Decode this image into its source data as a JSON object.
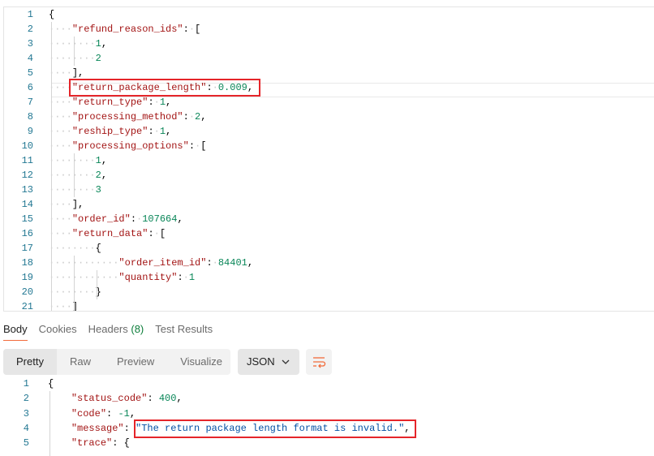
{
  "request_body": {
    "active_line": 6,
    "lines": [
      {
        "indent": 0,
        "tokens": [
          [
            "p",
            "{"
          ]
        ]
      },
      {
        "indent": 1,
        "tokens": [
          [
            "k",
            "\"refund_reason_ids\""
          ],
          [
            "p",
            ":"
          ],
          [
            "w",
            "·"
          ],
          [
            "p",
            "["
          ]
        ]
      },
      {
        "indent": 2,
        "tokens": [
          [
            "n",
            "1"
          ],
          [
            "p",
            ","
          ]
        ]
      },
      {
        "indent": 2,
        "tokens": [
          [
            "n",
            "2"
          ]
        ]
      },
      {
        "indent": 1,
        "tokens": [
          [
            "p",
            "],"
          ]
        ]
      },
      {
        "indent": 1,
        "tokens": [
          [
            "k",
            "\"return_package_length\""
          ],
          [
            "p",
            ":"
          ],
          [
            "w",
            "·"
          ],
          [
            "n",
            "0.009"
          ],
          [
            "p",
            ","
          ]
        ]
      },
      {
        "indent": 1,
        "tokens": [
          [
            "k",
            "\"return_type\""
          ],
          [
            "p",
            ":"
          ],
          [
            "w",
            "·"
          ],
          [
            "n",
            "1"
          ],
          [
            "p",
            ","
          ]
        ]
      },
      {
        "indent": 1,
        "tokens": [
          [
            "k",
            "\"processing_method\""
          ],
          [
            "p",
            ":"
          ],
          [
            "w",
            "·"
          ],
          [
            "n",
            "2"
          ],
          [
            "p",
            ","
          ]
        ]
      },
      {
        "indent": 1,
        "tokens": [
          [
            "k",
            "\"reship_type\""
          ],
          [
            "p",
            ":"
          ],
          [
            "w",
            "·"
          ],
          [
            "n",
            "1"
          ],
          [
            "p",
            ","
          ]
        ]
      },
      {
        "indent": 1,
        "tokens": [
          [
            "k",
            "\"processing_options\""
          ],
          [
            "p",
            ":"
          ],
          [
            "w",
            "·"
          ],
          [
            "p",
            "["
          ]
        ]
      },
      {
        "indent": 2,
        "tokens": [
          [
            "n",
            "1"
          ],
          [
            "p",
            ","
          ]
        ]
      },
      {
        "indent": 2,
        "tokens": [
          [
            "n",
            "2"
          ],
          [
            "p",
            ","
          ]
        ]
      },
      {
        "indent": 2,
        "tokens": [
          [
            "n",
            "3"
          ]
        ]
      },
      {
        "indent": 1,
        "tokens": [
          [
            "p",
            "],"
          ]
        ]
      },
      {
        "indent": 1,
        "tokens": [
          [
            "k",
            "\"order_id\""
          ],
          [
            "p",
            ":"
          ],
          [
            "w",
            "·"
          ],
          [
            "n",
            "107664"
          ],
          [
            "p",
            ","
          ]
        ]
      },
      {
        "indent": 1,
        "tokens": [
          [
            "k",
            "\"return_data\""
          ],
          [
            "p",
            ":"
          ],
          [
            "w",
            "·"
          ],
          [
            "p",
            "["
          ]
        ]
      },
      {
        "indent": 2,
        "tokens": [
          [
            "p",
            "{"
          ]
        ]
      },
      {
        "indent": 3,
        "tokens": [
          [
            "k",
            "\"order_item_id\""
          ],
          [
            "p",
            ":"
          ],
          [
            "w",
            "·"
          ],
          [
            "n",
            "84401"
          ],
          [
            "p",
            ","
          ]
        ]
      },
      {
        "indent": 3,
        "tokens": [
          [
            "k",
            "\"quantity\""
          ],
          [
            "p",
            ":"
          ],
          [
            "w",
            "·"
          ],
          [
            "n",
            "1"
          ]
        ]
      },
      {
        "indent": 2,
        "tokens": [
          [
            "p",
            "}"
          ]
        ]
      },
      {
        "indent": 1,
        "tokens": [
          [
            "p",
            "]"
          ]
        ]
      }
    ]
  },
  "response_tabs": [
    {
      "label": "Body"
    },
    {
      "label": "Cookies"
    },
    {
      "label": "Headers",
      "count": "(8)"
    },
    {
      "label": "Test Results"
    }
  ],
  "view_modes": [
    "Pretty",
    "Raw",
    "Preview",
    "Visualize"
  ],
  "format_select": {
    "value": "JSON",
    "chevron": "⌄"
  },
  "response_body": {
    "lines": [
      {
        "indent": 0,
        "tokens": [
          [
            "p",
            "{"
          ]
        ]
      },
      {
        "indent": 1,
        "tokens": [
          [
            "k",
            "\"status_code\""
          ],
          [
            "p",
            ": "
          ],
          [
            "n",
            "400"
          ],
          [
            "p",
            ","
          ]
        ]
      },
      {
        "indent": 1,
        "tokens": [
          [
            "k",
            "\"code\""
          ],
          [
            "p",
            ": "
          ],
          [
            "n",
            "-1"
          ],
          [
            "p",
            ","
          ]
        ]
      },
      {
        "indent": 1,
        "tokens": [
          [
            "k",
            "\"message\""
          ],
          [
            "p",
            ": "
          ],
          [
            "s",
            "\"The return package length format is invalid.\""
          ],
          [
            "p",
            ","
          ]
        ]
      },
      {
        "indent": 1,
        "tokens": [
          [
            "k",
            "\"trace\""
          ],
          [
            "p",
            ": "
          ],
          [
            "p",
            "{"
          ]
        ]
      }
    ]
  },
  "colors": {
    "accent": "#f26b3a",
    "highlight_box": "#e5252a",
    "key": "#a31515",
    "number": "#098658",
    "string": "#0451a5"
  }
}
